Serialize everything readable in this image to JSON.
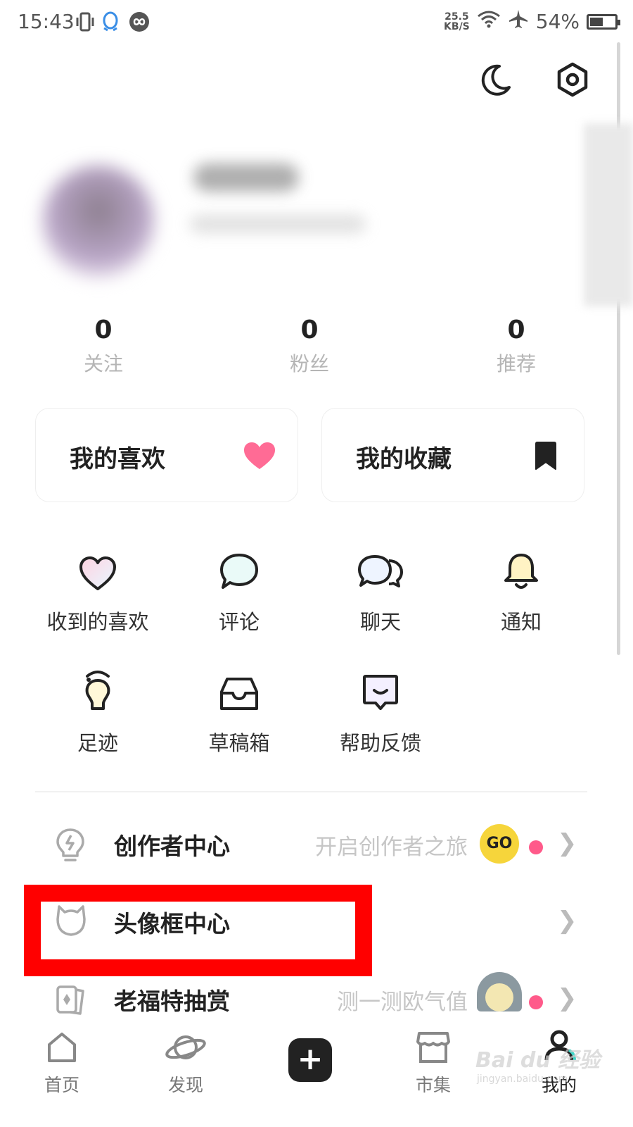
{
  "status_bar": {
    "time": "15:43",
    "speed_value": "25.5",
    "speed_unit": "KB/S",
    "battery": "54%"
  },
  "header": {
    "moon_icon": "moon-icon",
    "settings_icon": "hexagon-gear-icon"
  },
  "stats": [
    {
      "value": "0",
      "label": "关注"
    },
    {
      "value": "0",
      "label": "粉丝"
    },
    {
      "value": "0",
      "label": "推荐"
    }
  ],
  "cards": [
    {
      "label": "我的喜欢",
      "icon": "heart-icon",
      "color": "#ff6b95"
    },
    {
      "label": "我的收藏",
      "icon": "bookmark-icon",
      "color": "#222222"
    }
  ],
  "grid": [
    {
      "label": "收到的喜欢",
      "icon": "heart-outline-icon"
    },
    {
      "label": "评论",
      "icon": "comment-icon"
    },
    {
      "label": "聊天",
      "icon": "chat-icon"
    },
    {
      "label": "通知",
      "icon": "bell-icon"
    },
    {
      "label": "足迹",
      "icon": "footprint-bulb-icon"
    },
    {
      "label": "草稿箱",
      "icon": "inbox-icon"
    },
    {
      "label": "帮助反馈",
      "icon": "feedback-icon"
    }
  ],
  "rows": [
    {
      "label": "创作者中心",
      "subtitle": "开启创作者之旅",
      "badge": "GO",
      "icon": "bulb-icon"
    },
    {
      "label": "头像框中心",
      "subtitle": "",
      "icon": "cat-frame-icon"
    },
    {
      "label": "老福特抽赏",
      "subtitle": "测一测欧气值",
      "icon": "cards-icon"
    }
  ],
  "tabs": [
    {
      "label": "首页",
      "icon": "home-icon"
    },
    {
      "label": "发现",
      "icon": "planet-icon"
    },
    {
      "label": "",
      "icon": "plus-icon"
    },
    {
      "label": "市集",
      "icon": "shop-icon"
    },
    {
      "label": "我的",
      "icon": "person-icon"
    }
  ],
  "watermark": {
    "text": "Bai du 经验",
    "url": "jingyan.baidu.com"
  }
}
